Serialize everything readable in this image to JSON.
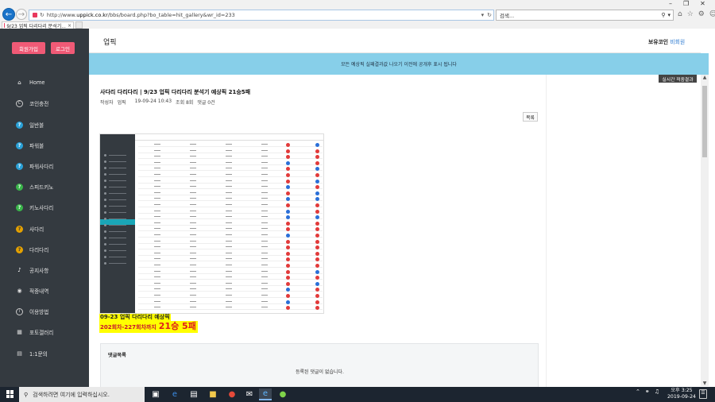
{
  "browser": {
    "url_prefix": "http://www.",
    "url_domain": "uppick.co.kr",
    "url_path": "/bbs/board.php?bo_table=hit_gallery&wr_id=233",
    "search_placeholder": "검색...",
    "tab_title": "9/23 업픽 다리다리 분석기...",
    "tab_close": "×"
  },
  "sidebar": {
    "join_label": "회원가입",
    "login_label": "로그인",
    "items": [
      {
        "label": "Home",
        "icon": "home-icon"
      },
      {
        "label": "코인충전",
        "icon": "coin-icon"
      },
      {
        "label": "일반볼",
        "icon": "help-circle-icon"
      },
      {
        "label": "파워볼",
        "icon": "help-circle-icon"
      },
      {
        "label": "파워사다리",
        "icon": "help-circle-icon"
      },
      {
        "label": "스피드키노",
        "icon": "help-circle-icon"
      },
      {
        "label": "키노사다리",
        "icon": "help-circle-icon"
      },
      {
        "label": "사다리",
        "icon": "help-circle-icon"
      },
      {
        "label": "다리다리",
        "icon": "help-circle-icon"
      },
      {
        "label": "공지사항",
        "icon": "bell-icon"
      },
      {
        "label": "적중내역",
        "icon": "target-icon"
      },
      {
        "label": "이용방법",
        "icon": "info-icon"
      },
      {
        "label": "포토갤러리",
        "icon": "gallery-icon"
      },
      {
        "label": "1:1문의",
        "icon": "chat-icon"
      }
    ]
  },
  "header": {
    "title": "업픽",
    "coin_label": "보유코인",
    "coin_value": "비회원"
  },
  "notice": "모든 예상픽 실패결과값 나오기 이전에 공개후 표시 됩니다",
  "live_badge": "실시간 적중결과",
  "post": {
    "title": "사다리 다리다리 | 9/23 업픽 다리다리 분석기 예상픽 21승5패",
    "author_label": "작성자",
    "author": "업픽",
    "date": "19-09-24 10:43",
    "views": "조회 8회",
    "comments": "댓글 0건",
    "list_button": "목록"
  },
  "caption": {
    "line1": "09-23 업픽 다리다리 예상픽",
    "line2_prefix": "202회차-227회차까지",
    "line2_big": "21승 5패"
  },
  "comments": {
    "title": "댓글목록",
    "empty": "등록된 댓글이 없습니다."
  },
  "taskbar": {
    "search_placeholder": "검색하려면 여기에 입력하십시오.",
    "time": "오후 3:25",
    "date": "2019-09-24"
  }
}
